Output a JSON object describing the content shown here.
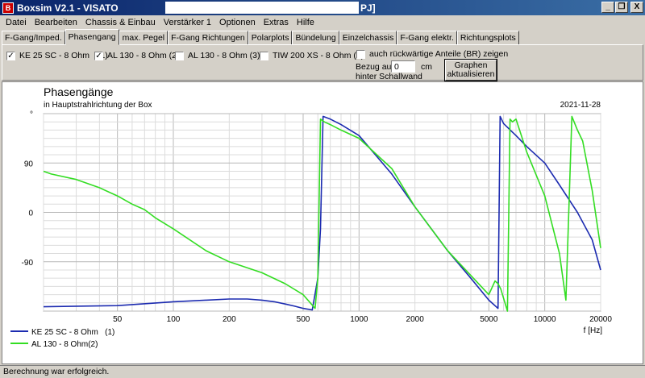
{
  "window": {
    "title": "Boxsim V2.1 - VISATO",
    "title_suffix": "PJ]",
    "min_label": "_",
    "restore_label": "❐",
    "close_label": "X"
  },
  "menu": [
    "Datei",
    "Bearbeiten",
    "Chassis & Einbau",
    "Verstärker 1",
    "Optionen",
    "Extras",
    "Hilfe"
  ],
  "tabs": [
    "F-Gang/Imped.",
    "Phasengang",
    "max. Pegel",
    "F-Gang Richtungen",
    "Polarplots",
    "Bündelung",
    "Einzelchassis",
    "F-Gang elektr.",
    "Richtungsplots"
  ],
  "active_tab": 1,
  "drivers": [
    {
      "label": "KE 25 SC - 8 Ohm",
      "num": "(1)",
      "checked": true,
      "mark": "✓"
    },
    {
      "label": "AL 130 - 8 Ohm (2)",
      "checked": true,
      "mark": "✓"
    },
    {
      "label": "AL 130 - 8 Ohm (3)",
      "checked": false,
      "mark": ""
    },
    {
      "label": "TIW 200 XS - 8 Ohm (4)",
      "checked": false,
      "mark": ""
    }
  ],
  "options": {
    "backward_label": "auch rückwärtige Anteile (BR) zeigen",
    "backward_checked": false,
    "bezug_label": "Bezug auf",
    "bezug_value": "0",
    "bezug_unit": "cm",
    "bezug_sub": "hinter Schallwand",
    "graph_button_line1": "Graphen",
    "graph_button_line2": "aktualisieren"
  },
  "chart_data": {
    "type": "line",
    "title": "Phasengänge",
    "subtitle": "in Hauptstrahlrichtung der Box",
    "date": "2021-11-28",
    "xlabel": "f [Hz]",
    "x_scale": "log",
    "xlim": [
      20,
      20000
    ],
    "ylim": [
      -180,
      180
    ],
    "x_ticks": [
      50,
      100,
      200,
      500,
      1000,
      2000,
      5000,
      10000,
      20000
    ],
    "y_ticks": [
      {
        "value": 180,
        "label": "°"
      },
      {
        "value": 90,
        "label": "90"
      },
      {
        "value": 0,
        "label": "0"
      },
      {
        "value": -90,
        "label": "-90"
      }
    ],
    "grid": true,
    "legend_position": "bottom-left",
    "series": [
      {
        "name": "KE 25 SC - 8 Ohm   (1)",
        "color": "#1c2bb0",
        "x": [
          20,
          50,
          100,
          150,
          200,
          250,
          300,
          350,
          400,
          450,
          500,
          560,
          600,
          620,
          640,
          700,
          800,
          1000,
          1500,
          2000,
          3000,
          4000,
          5000,
          5600,
          5750,
          5850,
          6000,
          7000,
          8000,
          10000,
          12000,
          15000,
          18000,
          20000
        ],
        "values": [
          -172,
          -170,
          -163,
          -160,
          -158,
          -158,
          -160,
          -163,
          -167,
          -171,
          -175,
          -178,
          -120,
          -30,
          175,
          170,
          160,
          140,
          70,
          10,
          -70,
          -120,
          -160,
          -175,
          175,
          170,
          162,
          140,
          120,
          90,
          50,
          0,
          -50,
          -105
        ]
      },
      {
        "name": "AL 130 - 8 Ohm(2)",
        "color": "#33dd22",
        "x": [
          20,
          22,
          30,
          40,
          50,
          60,
          70,
          80,
          100,
          150,
          200,
          300,
          400,
          500,
          580,
          600,
          620,
          650,
          700,
          800,
          1000,
          1500,
          2000,
          3000,
          4000,
          5000,
          5400,
          5600,
          5800,
          6300,
          6500,
          6700,
          7000,
          8000,
          10000,
          12000,
          13000,
          14000,
          15000,
          16000,
          18000,
          20000
        ],
        "values": [
          75,
          70,
          60,
          45,
          30,
          15,
          5,
          -10,
          -30,
          -70,
          -90,
          -110,
          -130,
          -150,
          -175,
          -120,
          170,
          165,
          160,
          150,
          135,
          80,
          10,
          -70,
          -115,
          -150,
          -125,
          -130,
          -140,
          -180,
          170,
          165,
          170,
          110,
          30,
          -75,
          -160,
          175,
          150,
          130,
          40,
          -65
        ]
      }
    ]
  },
  "status": "Berechnung war erfolgreich."
}
